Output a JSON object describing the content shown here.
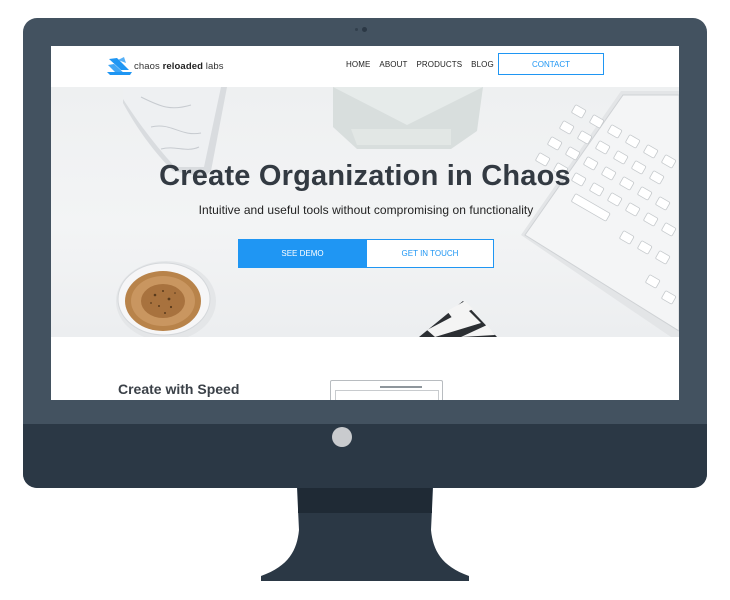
{
  "navbar": {
    "logo": {
      "word1": "chaos",
      "word2": "reloaded",
      "word3": "labs",
      "icon": "chaos-logo-icon"
    },
    "links": [
      "HOME",
      "ABOUT",
      "PRODUCTS",
      "BLOG"
    ],
    "contact_label": "CONTACT"
  },
  "hero": {
    "title": "Create Organization in Chaos",
    "subtitle": "Intuitive and useful tools without compromising on functionality",
    "primary_button": "SEE DEMO",
    "secondary_button": "GET IN TOUCH"
  },
  "features": {
    "first_title": "Create with Speed"
  },
  "colors": {
    "accent": "#1f96f3",
    "monitor_frame": "#435260",
    "monitor_chin": "#2b3845",
    "heading": "#333a42"
  }
}
